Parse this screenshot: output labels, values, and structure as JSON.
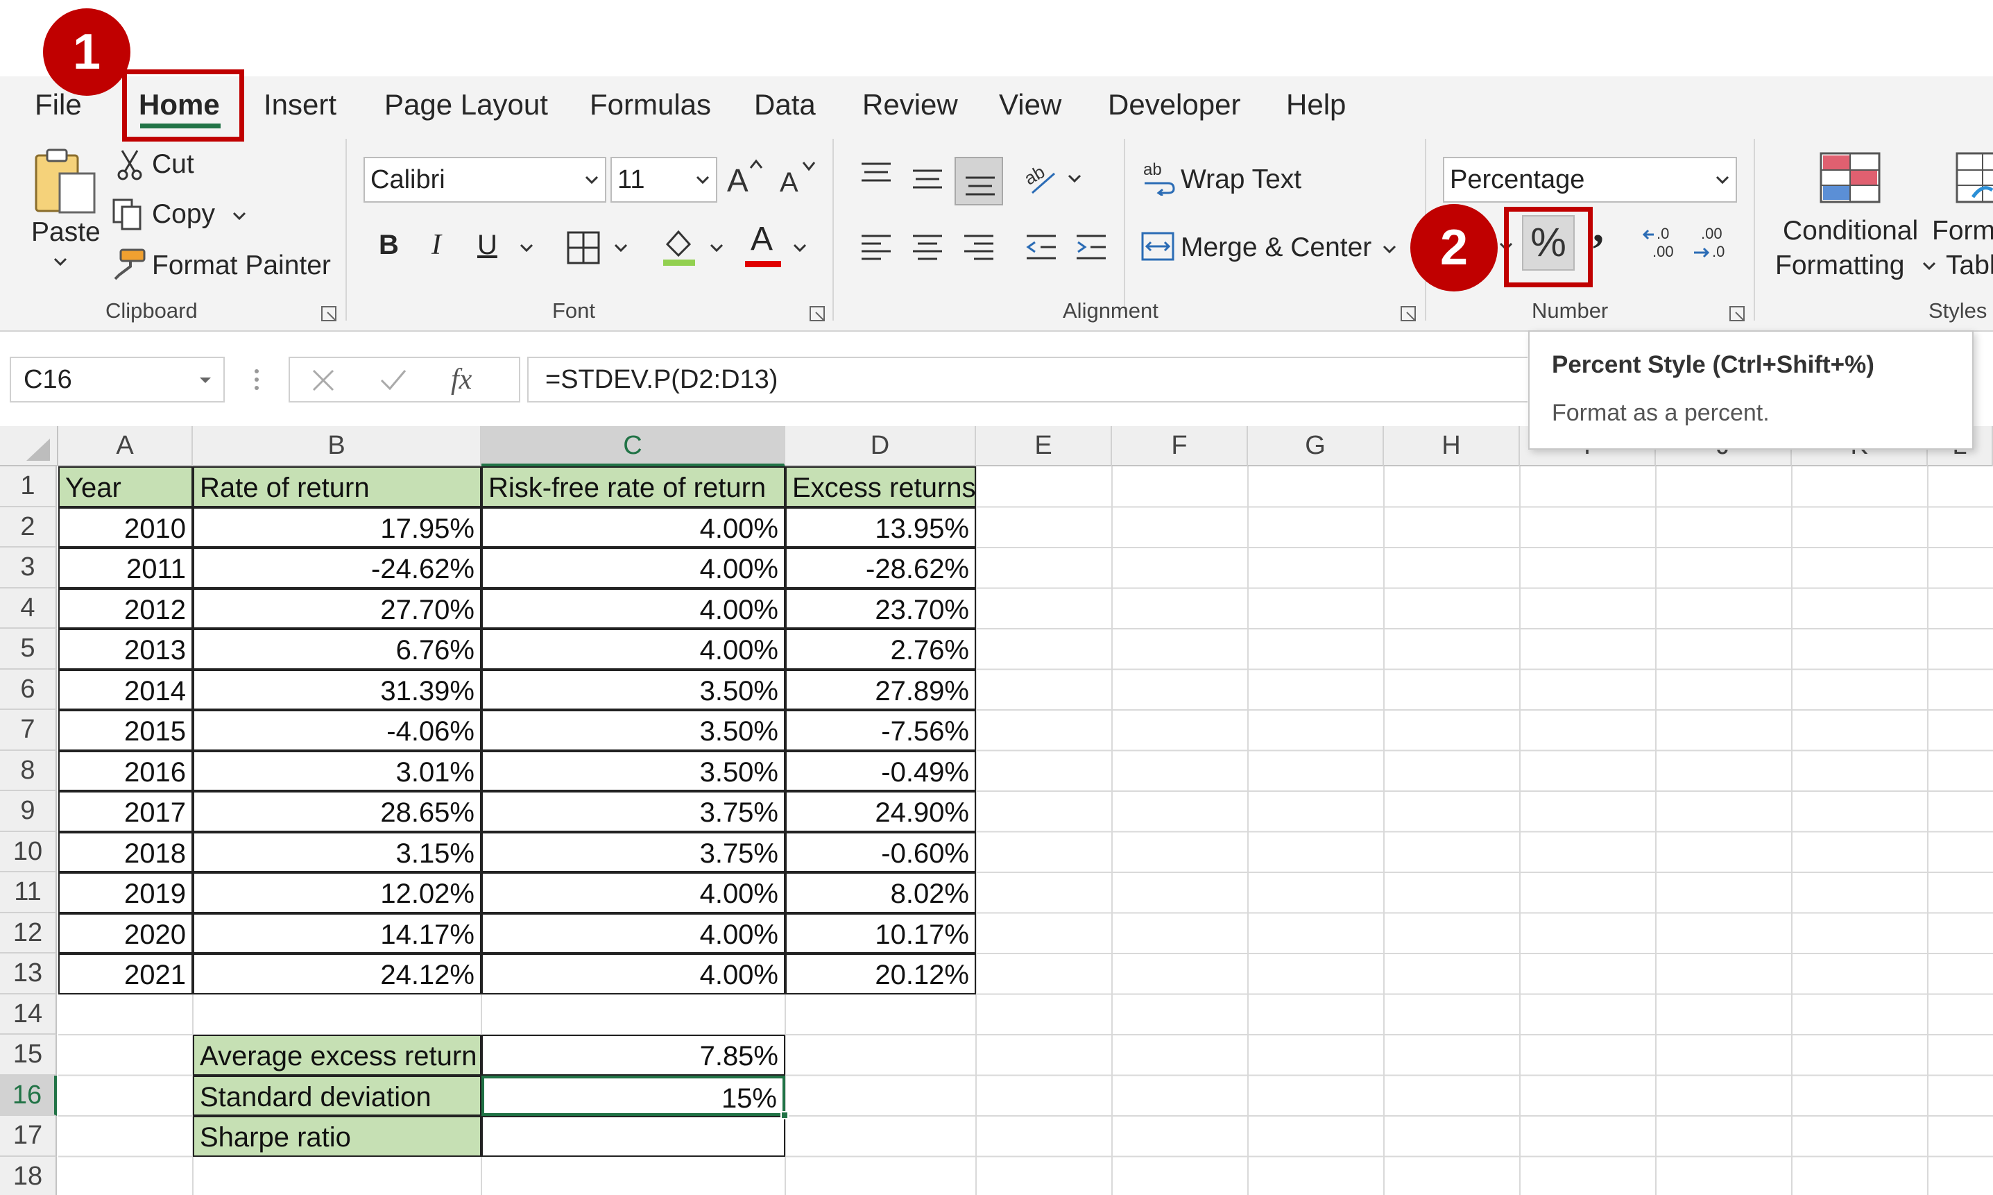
{
  "tabs": [
    "File",
    "Home",
    "Insert",
    "Page Layout",
    "Formulas",
    "Data",
    "Review",
    "View",
    "Developer",
    "Help"
  ],
  "active_tab": "Home",
  "clipboard": {
    "paste": "Paste",
    "cut": "Cut",
    "copy": "Copy",
    "format_painter": "Format Painter",
    "group": "Clipboard"
  },
  "font": {
    "name": "Calibri",
    "size": "11",
    "bold": "B",
    "italic": "I",
    "underline": "U",
    "color_letter": "A",
    "group": "Font"
  },
  "alignment": {
    "wrap_text": "Wrap Text",
    "merge_center": "Merge & Center",
    "group": "Alignment"
  },
  "number": {
    "format": "Percentage",
    "percent": "%",
    "comma": ",",
    "group": "Number"
  },
  "styles": {
    "conditional_line1": "Conditional",
    "conditional_line2": "Formatting",
    "format_table_line1": "Forma",
    "format_table_line2": "Tabl",
    "group": "Styles"
  },
  "formula_bar": {
    "name_box": "C16",
    "fx": "fx",
    "formula": "=STDEV.P(D2:D13)"
  },
  "tooltip": {
    "title": "Percent Style (Ctrl+Shift+%)",
    "body": "Format as a percent."
  },
  "badges": {
    "one": "1",
    "two": "2"
  },
  "columns": [
    "A",
    "B",
    "C",
    "D",
    "E",
    "F",
    "G",
    "H",
    "I",
    "J",
    "K",
    "L"
  ],
  "rows": [
    "1",
    "2",
    "3",
    "4",
    "5",
    "6",
    "7",
    "8",
    "9",
    "10",
    "11",
    "12",
    "13",
    "14",
    "15",
    "16",
    "17",
    "18"
  ],
  "selected_cell": {
    "column": "C",
    "row": "16"
  },
  "table": {
    "headers": [
      "Year",
      "Rate of return",
      "Risk-free rate of return",
      "Excess returns"
    ],
    "data": [
      [
        "2010",
        "17.95%",
        "4.00%",
        "13.95%"
      ],
      [
        "2011",
        "-24.62%",
        "4.00%",
        "-28.62%"
      ],
      [
        "2012",
        "27.70%",
        "4.00%",
        "23.70%"
      ],
      [
        "2013",
        "6.76%",
        "4.00%",
        "2.76%"
      ],
      [
        "2014",
        "31.39%",
        "3.50%",
        "27.89%"
      ],
      [
        "2015",
        "-4.06%",
        "3.50%",
        "-7.56%"
      ],
      [
        "2016",
        "3.01%",
        "3.50%",
        "-0.49%"
      ],
      [
        "2017",
        "28.65%",
        "3.75%",
        "24.90%"
      ],
      [
        "2018",
        "3.15%",
        "3.75%",
        "-0.60%"
      ],
      [
        "2019",
        "12.02%",
        "4.00%",
        "8.02%"
      ],
      [
        "2020",
        "14.17%",
        "4.00%",
        "10.17%"
      ],
      [
        "2021",
        "24.12%",
        "4.00%",
        "20.12%"
      ]
    ]
  },
  "summary": [
    {
      "label": "Average excess return",
      "value": "7.85%"
    },
    {
      "label": "Standard deviation",
      "value": "15%"
    },
    {
      "label": "Sharpe ratio",
      "value": ""
    }
  ],
  "colors": {
    "accent_green": "#217346",
    "header_fill": "#c6e0b4",
    "annotation_red": "#c00000"
  }
}
